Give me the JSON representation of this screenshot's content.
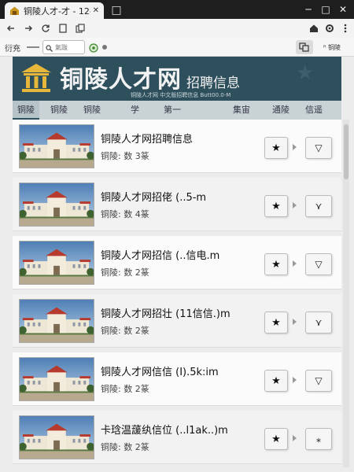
{
  "browser": {
    "tab_title": "铜陵人才-才 - 12-",
    "tab_close": "✕",
    "new_tab": "□",
    "window_controls": [
      "─",
      "□",
      "✕"
    ],
    "nav_icons": [
      "arrow-left-icon",
      "arrow-right-icon",
      "reload-icon",
      "page-icon",
      "copy-icon"
    ]
  },
  "bookmarks": {
    "label": "衍充",
    "search_text": "氣跋",
    "right_label": "ᴿ 铜陵"
  },
  "site": {
    "title": "铜陵人才网",
    "subtitle": "招聘信息",
    "tagline": "铜陵人才网 中文版招聘信息 Butt00.0-M"
  },
  "nav_tabs": [
    "铜陵",
    "铜陵",
    "铜陵",
    "学",
    "第一",
    "集宙",
    "通陵",
    "信遥"
  ],
  "listings": [
    {
      "title": "铜陵人才网招聘信息",
      "meta": "铜陵: 数 3篆",
      "star": "★",
      "drop": "▽"
    },
    {
      "title": "铜陵人才网招佬 (..5-m",
      "meta": "铜陵: 数 4篆",
      "star": "★",
      "drop": "⋎"
    },
    {
      "title": "铜陵人才网招信 (..信电.m",
      "meta": "铜陵: 数 2篆",
      "star": "★",
      "drop": "▽"
    },
    {
      "title": "铜陵人才网招壮 (11信信.)m",
      "meta": "铜陵: 数 2篆",
      "star": "★",
      "drop": "⋎"
    },
    {
      "title": "铜陵人才网信信 (I).5k:im",
      "meta": "铜陵: 数 2篆",
      "star": "★",
      "drop": "▽"
    },
    {
      "title": "卡琀温蘐纨信位 (..l1ak..)m",
      "meta": "铜陵: 数 2篆",
      "star": "★",
      "drop": "⁎"
    }
  ]
}
